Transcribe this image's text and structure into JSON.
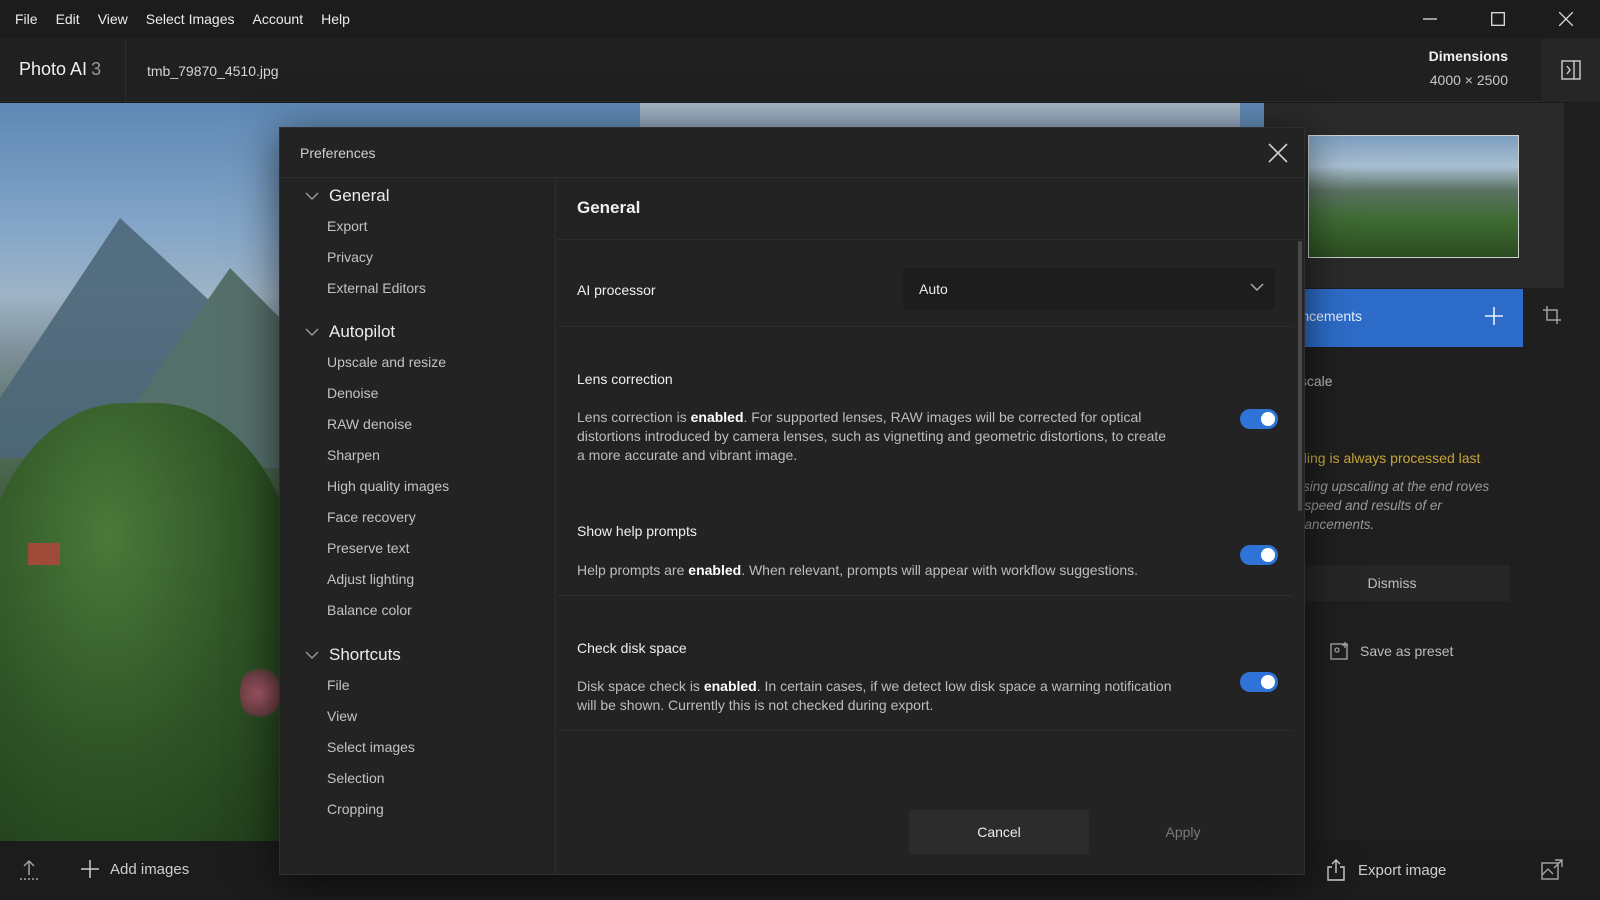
{
  "menubar": {
    "items": [
      "File",
      "Edit",
      "View",
      "Select Images",
      "Account",
      "Help"
    ]
  },
  "header": {
    "app_name": "Photo AI",
    "app_version": "3",
    "file_name": "tmb_79870_4510.jpg",
    "dimensions_label": "Dimensions",
    "dimensions_value": "4000 × 2500"
  },
  "right_panel": {
    "enhancements_label": "nhancements",
    "upscale_label": "Upscale",
    "note_title": "scaling is always processed last",
    "note_body": "cessing upscaling at the end roves the speed and results of er enhancements.",
    "dismiss_label": "Dismiss",
    "save_preset_label": "Save as preset"
  },
  "bottom_bar": {
    "add_images_label": "Add images",
    "export_image_label": "Export image"
  },
  "modal": {
    "title": "Preferences",
    "nav": {
      "groups": [
        {
          "label": "General",
          "items": [
            "Export",
            "Privacy",
            "External Editors"
          ]
        },
        {
          "label": "Autopilot",
          "items": [
            "Upscale and resize",
            "Denoise",
            "RAW denoise",
            "Sharpen",
            "High quality images",
            "Face recovery",
            "Preserve text",
            "Adjust lighting",
            "Balance color"
          ]
        },
        {
          "label": "Shortcuts",
          "items": [
            "File",
            "View",
            "Select images",
            "Selection",
            "Cropping"
          ]
        }
      ]
    },
    "content": {
      "title": "General",
      "ai_processor": {
        "label": "AI processor",
        "value": "Auto"
      },
      "lens_correction": {
        "label": "Lens correction",
        "desc_pre": "Lens correction is ",
        "desc_bold": "enabled",
        "desc_post": ". For supported lenses, RAW images will be corrected for optical distortions introduced by camera lenses, such as vignetting and geometric distortions, to create a more accurate and vibrant image.",
        "enabled": true
      },
      "help_prompts": {
        "label": "Show help prompts",
        "desc_pre": "Help prompts are ",
        "desc_bold": "enabled",
        "desc_post": ". When relevant, prompts will appear with workflow suggestions.",
        "enabled": true
      },
      "disk_space": {
        "label": "Check disk space",
        "desc_pre": "Disk space check is ",
        "desc_bold": "enabled",
        "desc_post": ". In certain cases, if we detect low disk space a warning notification will be shown. Currently this is not checked during export.",
        "enabled": true
      },
      "cancel_label": "Cancel",
      "apply_label": "Apply"
    }
  },
  "colors": {
    "accent": "#2f73d8",
    "enhancements_bar": "#2d6cc9",
    "note_title": "#c9a63a"
  }
}
